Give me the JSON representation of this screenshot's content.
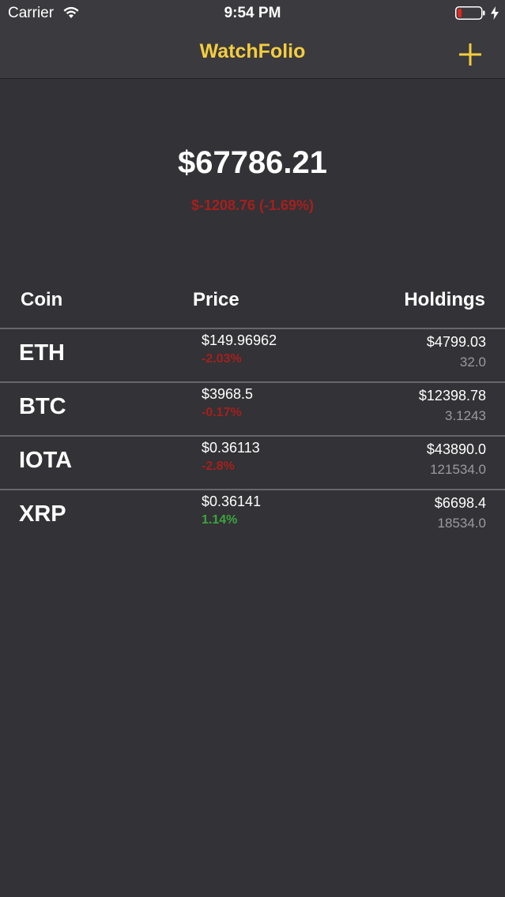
{
  "status_bar": {
    "carrier": "Carrier",
    "time": "9:54 PM"
  },
  "nav": {
    "title": "WatchFolio",
    "add_icon": "plus-icon"
  },
  "portfolio": {
    "total_value": "$67786.21",
    "total_change": "$-1208.76 (-1.69%)"
  },
  "table": {
    "headers": [
      "Coin",
      "Price",
      "Holdings"
    ],
    "rows": [
      {
        "symbol": "ETH",
        "price": "$149.96962",
        "change": "-2.03%",
        "value": "$4799.03",
        "amount": "32.0"
      },
      {
        "symbol": "BTC",
        "price": "$3968.5",
        "change": "-0.17%",
        "value": "$12398.78",
        "amount": "3.1243"
      },
      {
        "symbol": "IOTA",
        "price": "$0.36113",
        "change": "-2.8%",
        "value": "$43890.0",
        "amount": "121534.0"
      },
      {
        "symbol": "XRP",
        "price": "$0.36141",
        "change": "1.14%",
        "value": "$6698.4",
        "amount": "18534.0"
      }
    ]
  },
  "colors": {
    "accent": "#f4cd3f",
    "negative": "#a4201d",
    "positive": "#3aa53e",
    "background": "#333236"
  }
}
